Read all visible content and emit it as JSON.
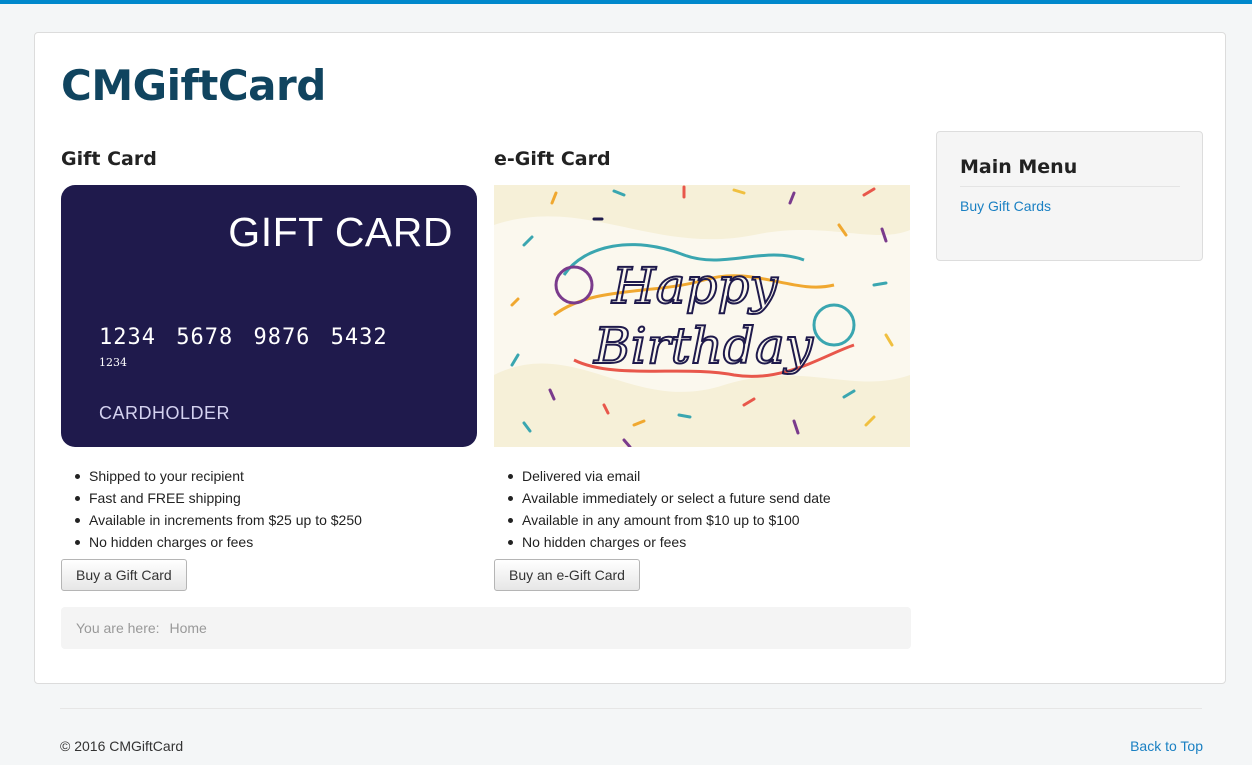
{
  "site": {
    "title": "CMGiftCard"
  },
  "gift_card": {
    "heading": "Gift Card",
    "image": {
      "title": "GIFT CARD",
      "number": "1234 5678 9876 5432",
      "sub_number": "1234",
      "holder": "CARDHOLDER"
    },
    "features": [
      "Shipped to your recipient",
      "Fast and FREE shipping",
      "Available in increments from $25 up to $250",
      "No hidden charges or fees"
    ],
    "button": "Buy a Gift Card"
  },
  "egift_card": {
    "heading": "e-Gift Card",
    "image": {
      "line1": "Happy",
      "line2": "Birthday"
    },
    "features": [
      "Delivered via email",
      "Available immediately or select a future send date",
      "Available in any amount from $10 up to $100",
      "No hidden charges or fees"
    ],
    "button": "Buy an e-Gift Card"
  },
  "breadcrumb": {
    "label": "You are here:",
    "current": "Home"
  },
  "sidebar": {
    "title": "Main Menu",
    "links": [
      "Buy Gift Cards"
    ]
  },
  "footer": {
    "copyright": "© 2016 CMGiftCard",
    "back_to_top": "Back to Top"
  },
  "colors": {
    "accent": "#0088cc",
    "title": "#10445f",
    "link": "#1a80c3",
    "card_bg": "#1f1a4c"
  }
}
